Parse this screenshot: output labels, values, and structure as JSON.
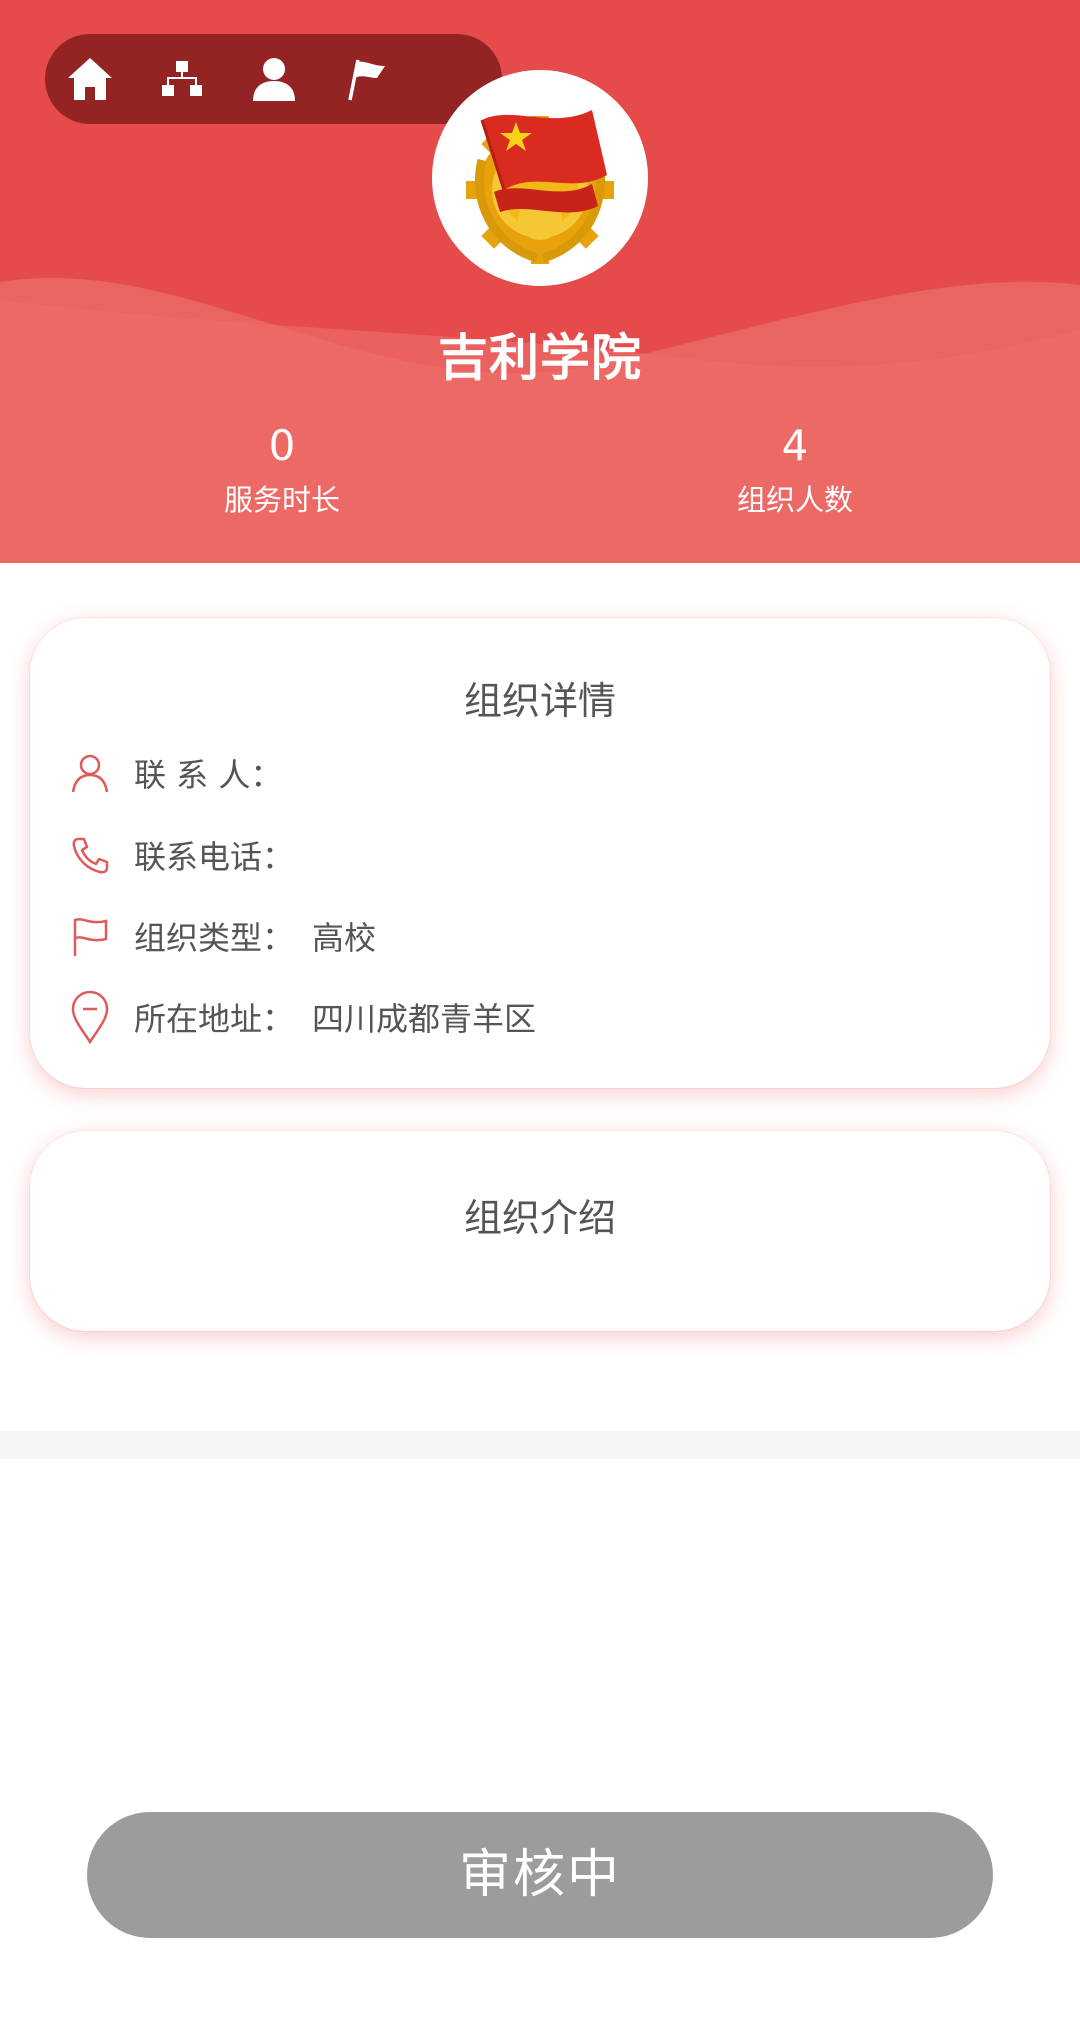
{
  "nav": {
    "icons": [
      "home-icon",
      "org-tree-icon",
      "user-icon",
      "flag-icon"
    ]
  },
  "header": {
    "org_name": "吉利学院",
    "stats": [
      {
        "value": "0",
        "label": "服务时长"
      },
      {
        "value": "4",
        "label": "组织人数"
      }
    ]
  },
  "details": {
    "title": "组织详情",
    "contact_label": "联 系 人：",
    "contact_value": "",
    "phone_label": "联系电话：",
    "phone_value": "",
    "type_label": "组织类型：",
    "type_value": "高校",
    "address_label": "所在地址：",
    "address_value": "四川成都青羊区"
  },
  "intro": {
    "title": "组织介绍",
    "content": ""
  },
  "status_button": {
    "label": "审核中"
  },
  "colors": {
    "primary": "#e54b4b",
    "nav_pill": "#7d1919",
    "button_disabled": "#9c9c9c",
    "text": "#555555"
  }
}
